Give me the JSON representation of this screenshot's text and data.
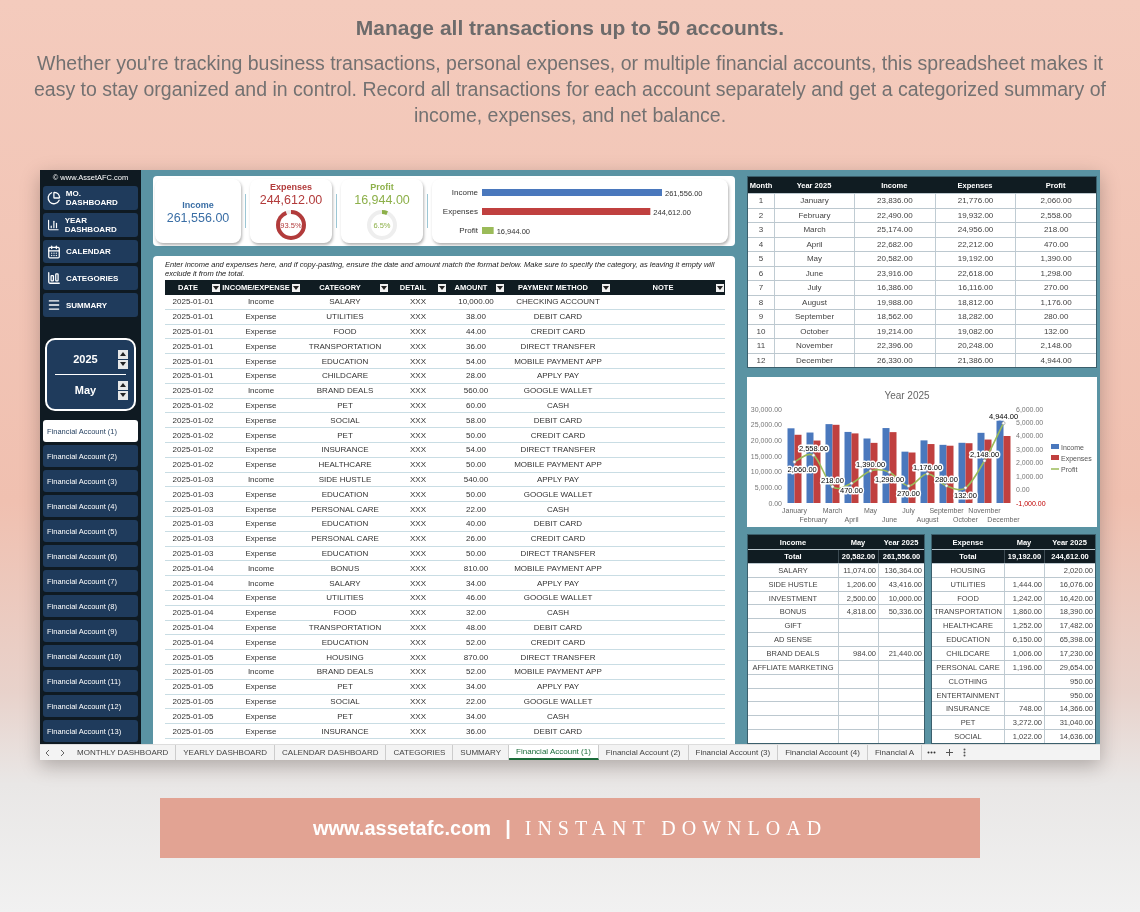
{
  "header": {
    "title": "Manage all transactions up to 50 accounts.",
    "description": "Whether you're tracking business transactions, personal expenses, or multiple financial accounts, this spreadsheet makes it easy to stay organized and in control. Record all transactions for each account separately and get a categorized summary of income, expenses, and net balance."
  },
  "sidebar": {
    "copyright": "© www.AssetAFC.com",
    "nav": [
      {
        "label": "MO. DASHBOARD"
      },
      {
        "label": "YEAR DASHBOARD"
      },
      {
        "label": "CALENDAR"
      },
      {
        "label": "CATEGORIES"
      },
      {
        "label": "SUMMARY"
      }
    ],
    "year": "2025",
    "month": "May",
    "accounts": [
      {
        "label": "Financial Account (1)",
        "selected": true
      },
      {
        "label": "Financial Account (2)",
        "selected": false
      },
      {
        "label": "Financial Account (3)",
        "selected": false
      },
      {
        "label": "Financial Account (4)",
        "selected": false
      },
      {
        "label": "Financial Account (5)",
        "selected": false
      },
      {
        "label": "Financial Account (6)",
        "selected": false
      },
      {
        "label": "Financial Account (7)",
        "selected": false
      },
      {
        "label": "Financial Account (8)",
        "selected": false
      },
      {
        "label": "Financial Account (9)",
        "selected": false
      },
      {
        "label": "Financial Account (10)",
        "selected": false
      },
      {
        "label": "Financial Account (11)",
        "selected": false
      },
      {
        "label": "Financial Account (12)",
        "selected": false
      },
      {
        "label": "Financial Account (13)",
        "selected": false
      }
    ]
  },
  "kpis": [
    {
      "label": "Income",
      "value": "261,556.00",
      "color": "#3a6ea5"
    },
    {
      "label": "Expenses",
      "value": "244,612.00",
      "color": "#b23b3b",
      "level": 0.935,
      "percent": "93.5%"
    },
    {
      "label": "Profit",
      "value": "16,944.00",
      "color": "#8db04a",
      "level": 0.065,
      "percent": "6.5%"
    }
  ],
  "totals_chart": {
    "chart_data": {
      "type": "bar",
      "orientation": "horizontal",
      "categories": [
        "Income",
        "Expenses",
        "Profit"
      ],
      "series": [
        {
          "values": [
            261556,
            244612,
            16944
          ],
          "value_labels": [
            "261,556.00",
            "244,612.00",
            "16,944.00"
          ]
        }
      ]
    }
  },
  "transactions": {
    "instruction": "Enter income and expenses here, and if copy-pasting, ensure the date and amount match the format below. Make sure to specify the category, as leaving it empty will exclude it from the total.",
    "columns": [
      "DATE",
      "INCOME/EXPENSE",
      "CATEGORY",
      "DETAIL",
      "AMOUNT",
      "PAYMENT METHOD",
      "NOTE"
    ],
    "rows": [
      [
        "2025-01-01",
        "Income",
        "SALARY",
        "XXX",
        "10,000.00",
        "CHECKING ACCOUNT"
      ],
      [
        "2025-01-01",
        "Expense",
        "UTILITIES",
        "XXX",
        "38.00",
        "DEBIT CARD"
      ],
      [
        "2025-01-01",
        "Expense",
        "FOOD",
        "XXX",
        "44.00",
        "CREDIT CARD"
      ],
      [
        "2025-01-01",
        "Expense",
        "TRANSPORTATION",
        "XXX",
        "36.00",
        "DIRECT TRANSFER"
      ],
      [
        "2025-01-01",
        "Expense",
        "EDUCATION",
        "XXX",
        "54.00",
        "MOBILE PAYMENT APP"
      ],
      [
        "2025-01-01",
        "Expense",
        "CHILDCARE",
        "XXX",
        "28.00",
        "APPLY PAY"
      ],
      [
        "2025-01-02",
        "Income",
        "BRAND DEALS",
        "XXX",
        "560.00",
        "GOOGLE WALLET"
      ],
      [
        "2025-01-02",
        "Expense",
        "PET",
        "XXX",
        "60.00",
        "CASH"
      ],
      [
        "2025-01-02",
        "Expense",
        "SOCIAL",
        "XXX",
        "58.00",
        "DEBIT CARD"
      ],
      [
        "2025-01-02",
        "Expense",
        "PET",
        "XXX",
        "50.00",
        "CREDIT CARD"
      ],
      [
        "2025-01-02",
        "Expense",
        "INSURANCE",
        "XXX",
        "54.00",
        "DIRECT TRANSFER"
      ],
      [
        "2025-01-02",
        "Expense",
        "HEALTHCARE",
        "XXX",
        "50.00",
        "MOBILE PAYMENT APP"
      ],
      [
        "2025-01-03",
        "Income",
        "SIDE HUSTLE",
        "XXX",
        "540.00",
        "APPLY PAY"
      ],
      [
        "2025-01-03",
        "Expense",
        "EDUCATION",
        "XXX",
        "50.00",
        "GOOGLE WALLET"
      ],
      [
        "2025-01-03",
        "Expense",
        "PERSONAL CARE",
        "XXX",
        "22.00",
        "CASH"
      ],
      [
        "2025-01-03",
        "Expense",
        "EDUCATION",
        "XXX",
        "40.00",
        "DEBIT CARD"
      ],
      [
        "2025-01-03",
        "Expense",
        "PERSONAL CARE",
        "XXX",
        "26.00",
        "CREDIT CARD"
      ],
      [
        "2025-01-03",
        "Expense",
        "EDUCATION",
        "XXX",
        "50.00",
        "DIRECT TRANSFER"
      ],
      [
        "2025-01-04",
        "Income",
        "BONUS",
        "XXX",
        "810.00",
        "MOBILE PAYMENT APP"
      ],
      [
        "2025-01-04",
        "Income",
        "SALARY",
        "XXX",
        "34.00",
        "APPLY PAY"
      ],
      [
        "2025-01-04",
        "Expense",
        "UTILITIES",
        "XXX",
        "46.00",
        "GOOGLE WALLET"
      ],
      [
        "2025-01-04",
        "Expense",
        "FOOD",
        "XXX",
        "32.00",
        "CASH"
      ],
      [
        "2025-01-04",
        "Expense",
        "TRANSPORTATION",
        "XXX",
        "48.00",
        "DEBIT CARD"
      ],
      [
        "2025-01-04",
        "Expense",
        "EDUCATION",
        "XXX",
        "52.00",
        "CREDIT CARD"
      ],
      [
        "2025-01-05",
        "Expense",
        "HOUSING",
        "XXX",
        "870.00",
        "DIRECT TRANSFER"
      ],
      [
        "2025-01-05",
        "Income",
        "BRAND DEALS",
        "XXX",
        "52.00",
        "MOBILE PAYMENT APP"
      ],
      [
        "2025-01-05",
        "Expense",
        "PET",
        "XXX",
        "34.00",
        "APPLY PAY"
      ],
      [
        "2025-01-05",
        "Expense",
        "SOCIAL",
        "XXX",
        "22.00",
        "GOOGLE WALLET"
      ],
      [
        "2025-01-05",
        "Expense",
        "PET",
        "XXX",
        "34.00",
        "CASH"
      ],
      [
        "2025-01-05",
        "Expense",
        "INSURANCE",
        "XXX",
        "36.00",
        "DEBIT CARD"
      ]
    ]
  },
  "monthly_table": {
    "columns": [
      "Month",
      "Year 2025",
      "Income",
      "Expenses",
      "Profit"
    ],
    "rows": [
      [
        "1",
        "January",
        "23,836.00",
        "21,776.00",
        "2,060.00"
      ],
      [
        "2",
        "February",
        "22,490.00",
        "19,932.00",
        "2,558.00"
      ],
      [
        "3",
        "March",
        "25,174.00",
        "24,956.00",
        "218.00"
      ],
      [
        "4",
        "April",
        "22,682.00",
        "22,212.00",
        "470.00"
      ],
      [
        "5",
        "May",
        "20,582.00",
        "19,192.00",
        "1,390.00"
      ],
      [
        "6",
        "June",
        "23,916.00",
        "22,618.00",
        "1,298.00"
      ],
      [
        "7",
        "July",
        "16,386.00",
        "16,116.00",
        "270.00"
      ],
      [
        "8",
        "August",
        "19,988.00",
        "18,812.00",
        "1,176.00"
      ],
      [
        "9",
        "September",
        "18,562.00",
        "18,282.00",
        "280.00"
      ],
      [
        "10",
        "October",
        "19,214.00",
        "19,082.00",
        "132.00"
      ],
      [
        "11",
        "November",
        "22,396.00",
        "20,248.00",
        "2,148.00"
      ],
      [
        "12",
        "December",
        "26,330.00",
        "21,386.00",
        "4,944.00"
      ]
    ]
  },
  "year_chart": {
    "chart_data": {
      "type": "bar",
      "title": "Year 2025",
      "categories": [
        "January",
        "February",
        "March",
        "April",
        "May",
        "June",
        "July",
        "August",
        "September",
        "October",
        "November",
        "December"
      ],
      "series": [
        {
          "name": "Income",
          "type": "bar",
          "color": "#4a78bd",
          "values": [
            23836,
            22490,
            25174,
            22682,
            20582,
            23916,
            16386,
            19988,
            18562,
            19214,
            22396,
            26330
          ]
        },
        {
          "name": "Expenses",
          "type": "bar",
          "color": "#c0403f",
          "values": [
            21776,
            19932,
            24956,
            22212,
            19192,
            22618,
            16116,
            18812,
            18282,
            19082,
            20248,
            21386
          ]
        }
      ],
      "ylim": [
        0,
        30000
      ],
      "yticks": [
        {
          "value": 0,
          "label": "0.00"
        },
        {
          "value": 5000,
          "label": "5,000.00"
        },
        {
          "value": 10000,
          "label": "10,000.00"
        },
        {
          "value": 15000,
          "label": "15,000.00"
        },
        {
          "value": 20000,
          "label": "20,000.00"
        },
        {
          "value": 25000,
          "label": "25,000.00"
        },
        {
          "value": 30000,
          "label": "30,000.00"
        }
      ],
      "legend": "right"
    },
    "profit_chart": {
      "chart_data": {
        "type": "line",
        "series": [
          {
            "name": "Profit",
            "color": "#9bbb59",
            "marker": "circle",
            "values": [
              2060,
              2558,
              218,
              470,
              1390,
              1298,
              270,
              1176,
              280,
              132,
              2148,
              4944
            ],
            "value_labels": [
              "2,060.00",
              "2,558.00",
              "218.00",
              "470.00",
              "1,390.00",
              "1,298.00",
              "270.00",
              "1,176.00",
              "280.00",
              "132.00",
              "2,148.00",
              "4,944.00"
            ]
          }
        ],
        "ylim": [
          -1000,
          6000
        ],
        "yticks": [
          {
            "value": -1000,
            "label": "-1,000.00"
          },
          {
            "value": 0,
            "label": "0.00"
          },
          {
            "value": 1000,
            "label": "1,000.00"
          },
          {
            "value": 2000,
            "label": "2,000.00"
          },
          {
            "value": 3000,
            "label": "3,000.00"
          },
          {
            "value": 4000,
            "label": "4,000.00"
          },
          {
            "value": 5000,
            "label": "5,000.00"
          },
          {
            "value": 6000,
            "label": "6,000.00"
          }
        ]
      }
    }
  },
  "income_summary": {
    "columns": [
      "Income",
      "May",
      "Year 2025"
    ],
    "total": [
      "Total",
      "20,582.00",
      "261,556.00"
    ],
    "rows": [
      {
        "name": "SALARY",
        "may": "11,074.00",
        "year": "136,364.00"
      },
      {
        "name": "SIDE HUSTLE",
        "may": "1,206.00",
        "year": "43,416.00"
      },
      {
        "name": "INVESTMENT",
        "may": "2,500.00",
        "year": "10,000.00"
      },
      {
        "name": "BONUS",
        "may": "4,818.00",
        "year": "50,336.00"
      },
      {
        "name": "GIFT"
      },
      {
        "name": "AD SENSE"
      },
      {
        "name": "BRAND DEALS",
        "may": "984.00",
        "year": "21,440.00"
      },
      {
        "name": "AFFLIATE MARKETING"
      }
    ]
  },
  "expense_summary": {
    "columns": [
      "Expense",
      "May",
      "Year 2025"
    ],
    "total": [
      "Total",
      "19,192.00",
      "244,612.00"
    ],
    "rows": [
      {
        "name": "HOUSING",
        "year": "2,020.00"
      },
      {
        "name": "UTILITIES",
        "may": "1,444.00",
        "year": "16,076.00"
      },
      {
        "name": "FOOD",
        "may": "1,242.00",
        "year": "16,420.00"
      },
      {
        "name": "TRANSPORTATION",
        "may": "1,860.00",
        "year": "18,390.00"
      },
      {
        "name": "HEALTHCARE",
        "may": "1,252.00",
        "year": "17,482.00"
      },
      {
        "name": "EDUCATION",
        "may": "6,150.00",
        "year": "65,398.00"
      },
      {
        "name": "CHILDCARE",
        "may": "1,006.00",
        "year": "17,230.00"
      },
      {
        "name": "PERSONAL CARE",
        "may": "1,196.00",
        "year": "29,654.00"
      },
      {
        "name": "CLOTHING",
        "year": "950.00"
      },
      {
        "name": "ENTERTAINMENT",
        "year": "950.00"
      },
      {
        "name": "INSURANCE",
        "may": "748.00",
        "year": "14,366.00"
      },
      {
        "name": "PET",
        "may": "3,272.00",
        "year": "31,040.00"
      },
      {
        "name": "SOCIAL",
        "may": "1,022.00",
        "year": "14,636.00"
      }
    ]
  },
  "sheet_tabs": [
    {
      "label": "MONTHLY DASHBOARD",
      "selected": false
    },
    {
      "label": "YEARLY DASHBOARD",
      "selected": false
    },
    {
      "label": "CALENDAR DASHBOARD",
      "selected": false
    },
    {
      "label": "CATEGORIES",
      "selected": false
    },
    {
      "label": "SUMMARY",
      "selected": false
    },
    {
      "label": "Financial Account (1)",
      "selected": true
    },
    {
      "label": "Financial Account (2)",
      "selected": false
    },
    {
      "label": "Financial Account (3)",
      "selected": false
    },
    {
      "label": "Financial Account (4)",
      "selected": false
    },
    {
      "label": "Financial A",
      "selected": false
    }
  ],
  "banner": {
    "site": "www.assetafc.com",
    "separator": "|",
    "tagline": "INSTANT DOWNLOAD"
  }
}
